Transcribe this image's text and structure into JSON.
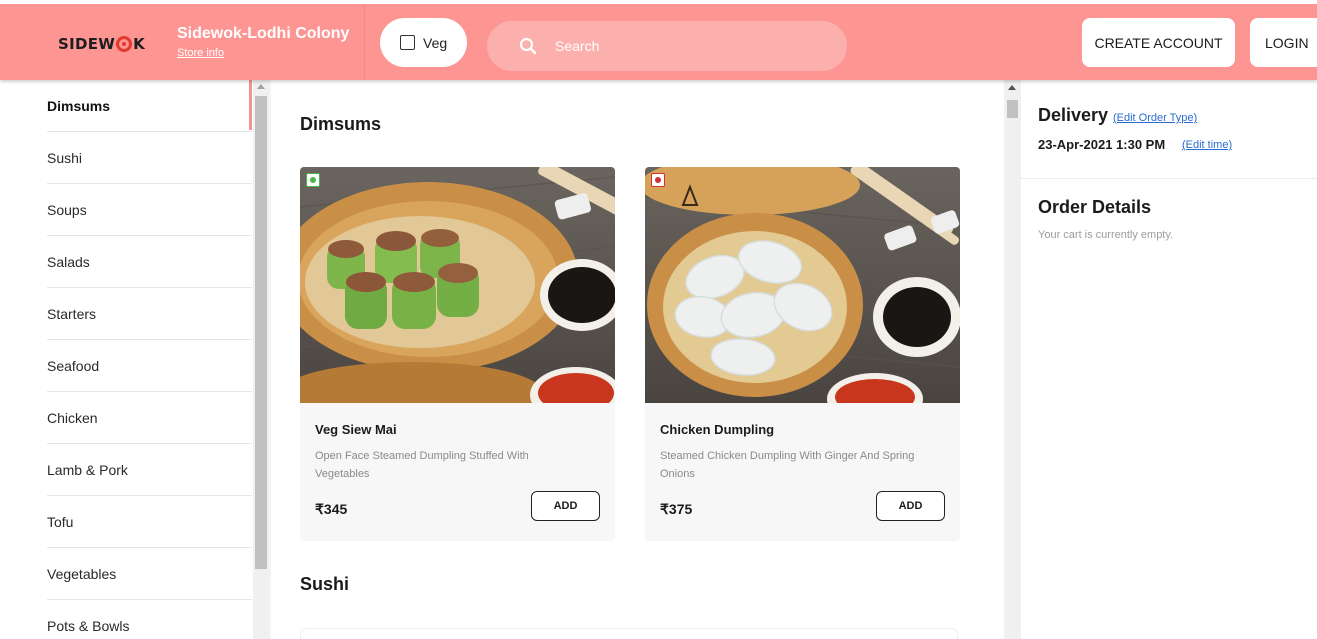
{
  "header": {
    "logo_text_1": "SIDEW",
    "logo_text_2": "K",
    "store_name": "Sidewok-Lodhi Colony",
    "store_info_link": "Store info",
    "veg_label": "Veg",
    "search_placeholder": "Search",
    "create_account_label": "CREATE ACCOUNT",
    "login_label": "LOGIN"
  },
  "sidebar": {
    "items": [
      {
        "label": "Dimsums",
        "active": true
      },
      {
        "label": "Sushi"
      },
      {
        "label": "Soups"
      },
      {
        "label": "Salads"
      },
      {
        "label": "Starters"
      },
      {
        "label": "Seafood"
      },
      {
        "label": "Chicken"
      },
      {
        "label": "Lamb & Pork"
      },
      {
        "label": "Tofu"
      },
      {
        "label": "Vegetables"
      },
      {
        "label": "Pots & Bowls"
      }
    ]
  },
  "main": {
    "sections": [
      {
        "title": "Dimsums",
        "items": [
          {
            "name": "Veg Siew Mai",
            "description": "Open Face Steamed Dumpling Stuffed With Vegetables",
            "price": "₹345",
            "add_label": "ADD",
            "diet": "veg"
          },
          {
            "name": "Chicken Dumpling",
            "description": "Steamed Chicken Dumpling With Ginger And Spring Onions",
            "price": "₹375",
            "add_label": "ADD",
            "diet": "non-veg"
          }
        ]
      },
      {
        "title": "Sushi",
        "items": []
      }
    ]
  },
  "order_panel": {
    "delivery_title": "Delivery",
    "edit_order_type": "(Edit Order Type)",
    "delivery_time": "23-Apr-2021 1:30 PM",
    "edit_time": "(Edit time)",
    "order_details_title": "Order Details",
    "cart_empty_text": "Your cart is currently empty."
  },
  "colors": {
    "header_bg": "#fd9593",
    "search_bg": "#fcb0ae",
    "active_indicator": "#f49490",
    "link": "#2a6bd0",
    "veg_mark": "#49b649",
    "nonveg_mark": "#d32f2f"
  },
  "icons": {
    "search": "search-icon",
    "veg_checkbox": "checkbox-icon"
  }
}
